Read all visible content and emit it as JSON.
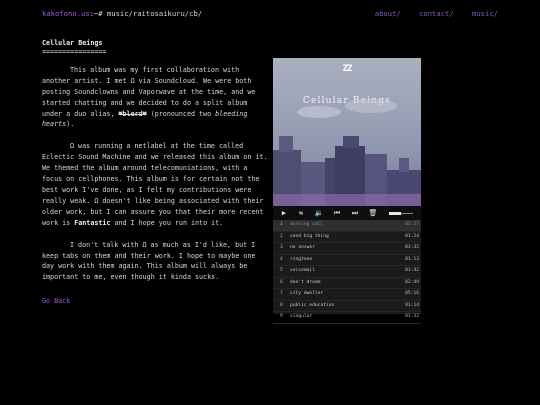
{
  "header": {
    "host": "kakofono.us",
    "path": ":~# music/raitosaikuru/cb/",
    "nav": [
      "about/",
      "contact/",
      "music/"
    ]
  },
  "article": {
    "title": "Cellular Beings",
    "underline": "================",
    "p1_a": "This album was my first collaboration with another artist. I met Ω via Soundcloud. We were both posting Soundclowns and Vaporwave at the time, and we started chatting and we decided to do a split album under a duo alias, ",
    "p1_alias": "♥blerd♥",
    "p1_b": " (pronounced two ",
    "p1_em": "bleeding hearts",
    "p1_c": ").",
    "p2_a": "Ω was running a netlabel at the time called Eclectic Sound Machine and we released this album on it. We themed the album around telecomuniations, with a focus on cellphones. This album is for certain not the best work I've done, as I felt my contributions were really weak. Ω doesn't like being associated with their older work, but I can assure you that their more recent work is ",
    "p2_bold": "Fantastic",
    "p2_b": " and I hope you run into it.",
    "p3": "I don't talk with Ω as much as I'd like, but I keep tabs on them and their work. I hope to maybe one day work with them again. This album will always be important to me, even though it kinda sucks.",
    "back_label": "Go Back"
  },
  "player": {
    "cover_logo": "ZZ",
    "cover_title": "Cellular Beings",
    "controls": {
      "play": "▶",
      "repeat": "⇆",
      "volume": "🔉",
      "prev": "⏮",
      "next": "⏭",
      "trash": "🗑"
    },
    "volume_level": 0.5,
    "tracks": [
      {
        "num": "1",
        "name": "morning call",
        "time": "01:27"
      },
      {
        "num": "2",
        "name": "send big thing",
        "time": "01:24"
      },
      {
        "num": "3",
        "name": "no answer",
        "time": "03:32"
      },
      {
        "num": "4",
        "name": "ringtone",
        "time": "01:13"
      },
      {
        "num": "5",
        "name": "voicemail",
        "time": "01:42"
      },
      {
        "num": "6",
        "name": "don't dream",
        "time": "02:49"
      },
      {
        "num": "7",
        "name": "city dweller",
        "time": "05:16"
      },
      {
        "num": "8",
        "name": "public education",
        "time": "01:14"
      },
      {
        "num": "9",
        "name": "singular",
        "time": "01:32"
      }
    ]
  }
}
